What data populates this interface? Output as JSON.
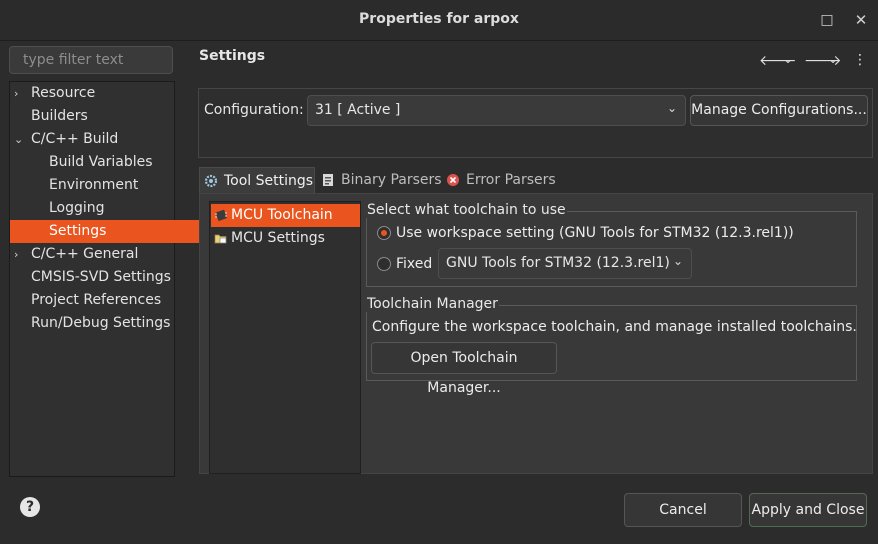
{
  "window": {
    "title": "Properties for arpox",
    "maximize_icon": "□",
    "close_icon": "✕"
  },
  "filter": {
    "placeholder": "type filter text"
  },
  "tree": [
    {
      "label": "Resource",
      "expander": "›"
    },
    {
      "label": "Builders",
      "expander": ""
    },
    {
      "label": "C/C++ Build",
      "expander": "⌄"
    },
    {
      "label": "Build Variables",
      "expander": ""
    },
    {
      "label": "Environment",
      "expander": ""
    },
    {
      "label": "Logging",
      "expander": ""
    },
    {
      "label": "Settings",
      "expander": "",
      "selected": true
    },
    {
      "label": "C/C++ General",
      "expander": "›"
    },
    {
      "label": "CMSIS-SVD Settings",
      "expander": ""
    },
    {
      "label": "Project References",
      "expander": ""
    },
    {
      "label": "Run/Debug Settings",
      "expander": ""
    }
  ],
  "help_icon": "?",
  "page": {
    "heading": "Settings",
    "nav_icons": {
      "back": "🡐",
      "back_menu": "⌄",
      "forward": "🡒",
      "forward_menu": "⌄",
      "more": "⋮"
    }
  },
  "configuration": {
    "label": "Configuration:",
    "value": "31  [ Active ]",
    "arrow": "⌄",
    "manage_button": "Manage Configurations..."
  },
  "tabs": [
    {
      "label": "Tool Settings",
      "icon": "gear-icon",
      "active": true
    },
    {
      "label": "Binary Parsers",
      "icon": "binary-icon",
      "active": false
    },
    {
      "label": "Error Parsers",
      "icon": "error-icon",
      "active": false
    }
  ],
  "tool_list": [
    {
      "label": "MCU Toolchain",
      "icon": "chip-icon",
      "selected": true
    },
    {
      "label": "MCU Settings",
      "icon": "folder-icon",
      "selected": false
    }
  ],
  "toolchain_group": {
    "title": "Select what toolchain to use",
    "option_workspace": "Use workspace setting (GNU Tools for STM32 (12.3.rel1))",
    "option_fixed": "Fixed",
    "fixed_value": "GNU Tools for STM32 (12.3.rel1)",
    "fixed_arrow": "⌄",
    "selected": "workspace"
  },
  "manager_group": {
    "title": "Toolchain Manager",
    "description": "Configure the workspace toolchain, and manage installed toolchains.",
    "button": "Open Toolchain Manager..."
  },
  "footer": {
    "cancel": "Cancel",
    "apply_close": "Apply and Close"
  },
  "colors": {
    "accent": "#e9541f",
    "background": "#2c2c2c",
    "panel": "#393939"
  }
}
